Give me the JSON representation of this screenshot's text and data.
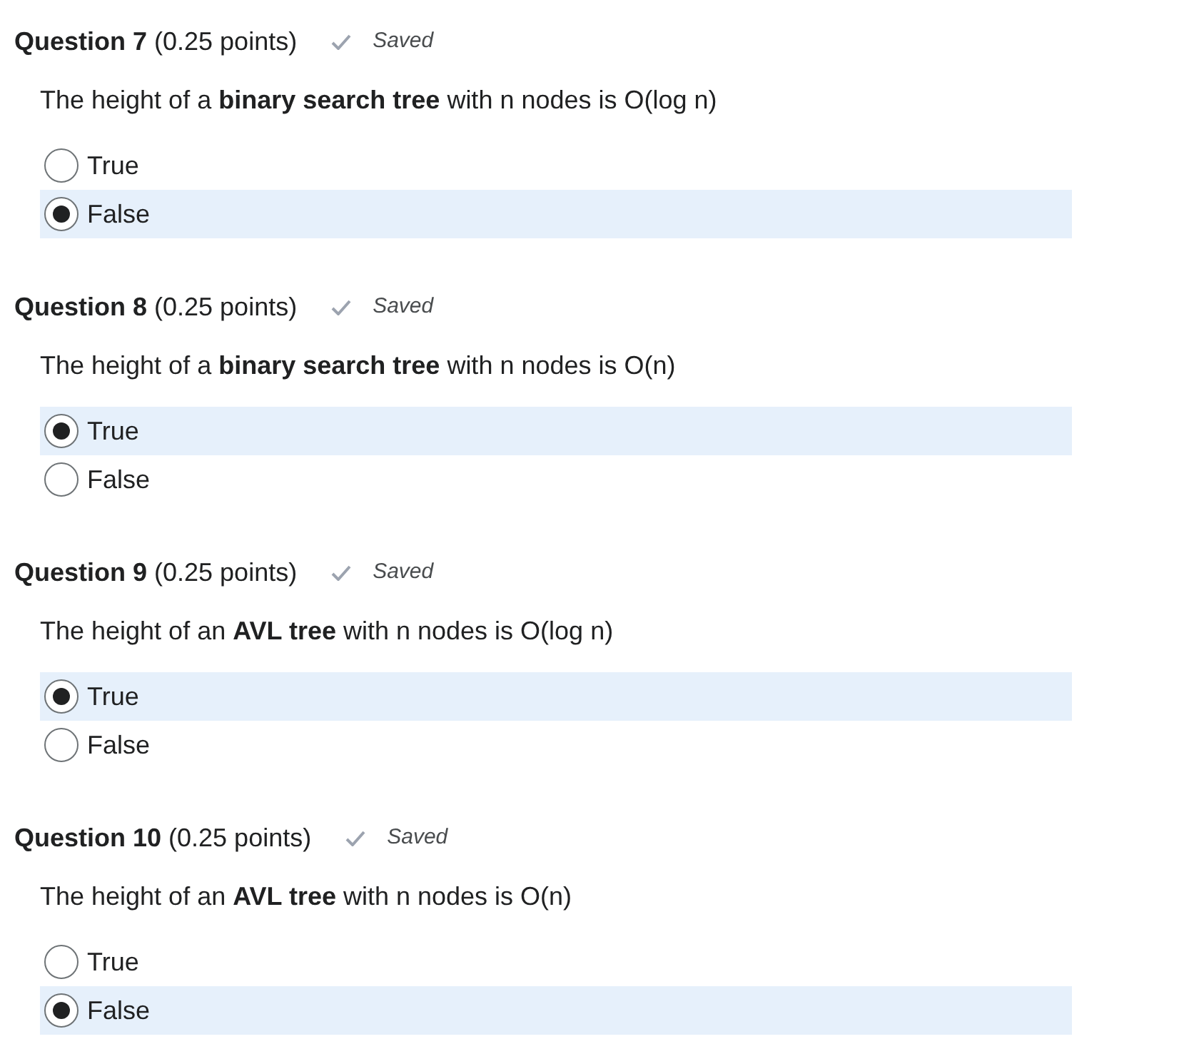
{
  "questions": [
    {
      "title": "Question 7",
      "points": "(0.25 points)",
      "status": "Saved",
      "prompt": "The height of a **binary search tree** with n nodes is O(log n)",
      "options": [
        {
          "label": "True",
          "selected": false
        },
        {
          "label": "False",
          "selected": true
        }
      ]
    },
    {
      "title": "Question 8",
      "points": "(0.25 points)",
      "status": "Saved",
      "prompt": "The height of a **binary search tree** with n nodes is O(n)",
      "options": [
        {
          "label": "True",
          "selected": true
        },
        {
          "label": "False",
          "selected": false
        }
      ]
    },
    {
      "title": "Question 9",
      "points": "(0.25 points)",
      "status": "Saved",
      "prompt": "The height of an **AVL tree** with n nodes is O(log n)",
      "options": [
        {
          "label": "True",
          "selected": true
        },
        {
          "label": "False",
          "selected": false
        }
      ]
    },
    {
      "title": "Question 10",
      "points": "(0.25 points)",
      "status": "Saved",
      "prompt": "The height of an **AVL tree** with n nodes is O(n)",
      "options": [
        {
          "label": "True",
          "selected": false
        },
        {
          "label": "False",
          "selected": true
        }
      ]
    }
  ]
}
